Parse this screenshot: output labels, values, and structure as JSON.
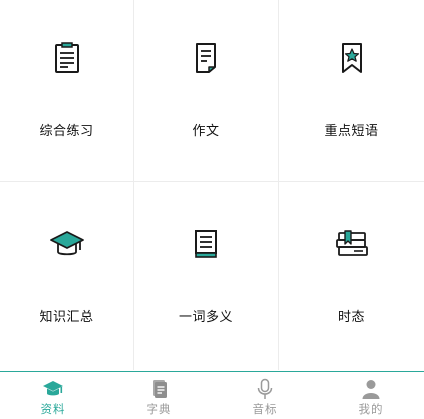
{
  "colors": {
    "accent": "#2aa89a",
    "icon": "#1a1a1a",
    "inactive": "#9a9a9a"
  },
  "grid": {
    "items": [
      {
        "label": "综合练习",
        "icon": "clipboard-icon"
      },
      {
        "label": "作文",
        "icon": "document-icon"
      },
      {
        "label": "重点短语",
        "icon": "bookmark-star-icon"
      },
      {
        "label": "知识汇总",
        "icon": "graduation-cap-icon"
      },
      {
        "label": "一词多义",
        "icon": "book-icon"
      },
      {
        "label": "时态",
        "icon": "book-stack-icon"
      }
    ]
  },
  "tabbar": {
    "active": 0,
    "items": [
      {
        "label": "资料",
        "icon": "graduation-cap-icon"
      },
      {
        "label": "字典",
        "icon": "dictionary-icon"
      },
      {
        "label": "音标",
        "icon": "microphone-icon"
      },
      {
        "label": "我的",
        "icon": "person-icon"
      }
    ]
  }
}
